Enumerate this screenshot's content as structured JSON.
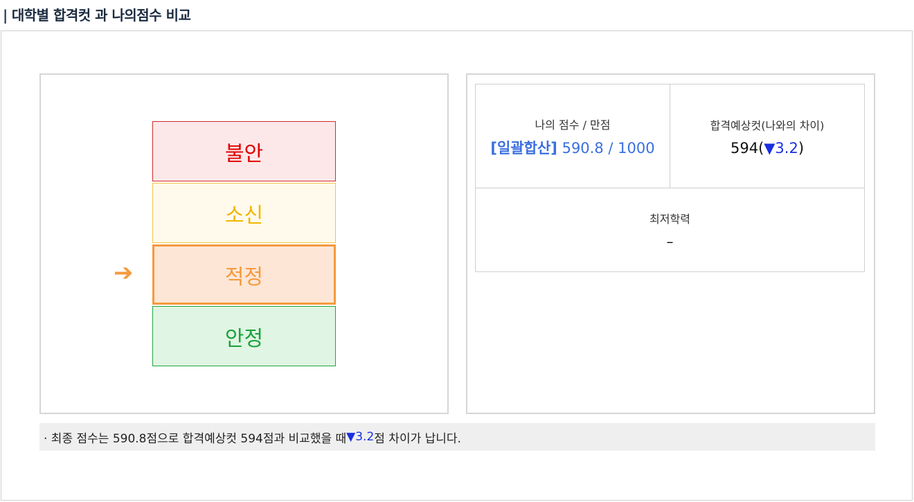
{
  "title": "대학별 합격컷 과 나의점수 비교",
  "title_bar": "|",
  "levels": [
    {
      "label": "불안",
      "color": "#e00000"
    },
    {
      "label": "소신",
      "color": "#f2b600"
    },
    {
      "label": "적정",
      "color": "#f59a3c"
    },
    {
      "label": "안정",
      "color": "#18a23b"
    }
  ],
  "current_level_arrow": "➔",
  "score": {
    "label": "나의 점수 / 만점",
    "type": "[일괄합산]",
    "value": "590.8 / 1000"
  },
  "cut": {
    "label": "합격예상컷(나와의 차이)",
    "value_prefix": "594(",
    "diff": "▼3.2",
    "value_suffix": ")"
  },
  "minimum": {
    "label": "최저학력",
    "value": "–"
  },
  "note": {
    "prefix": "· 최종 점수는 590.8점으로 합격예상컷 594점과 비교했을 때 ",
    "diff": "▼3.2",
    "suffix": "점 차이가 납니다."
  }
}
